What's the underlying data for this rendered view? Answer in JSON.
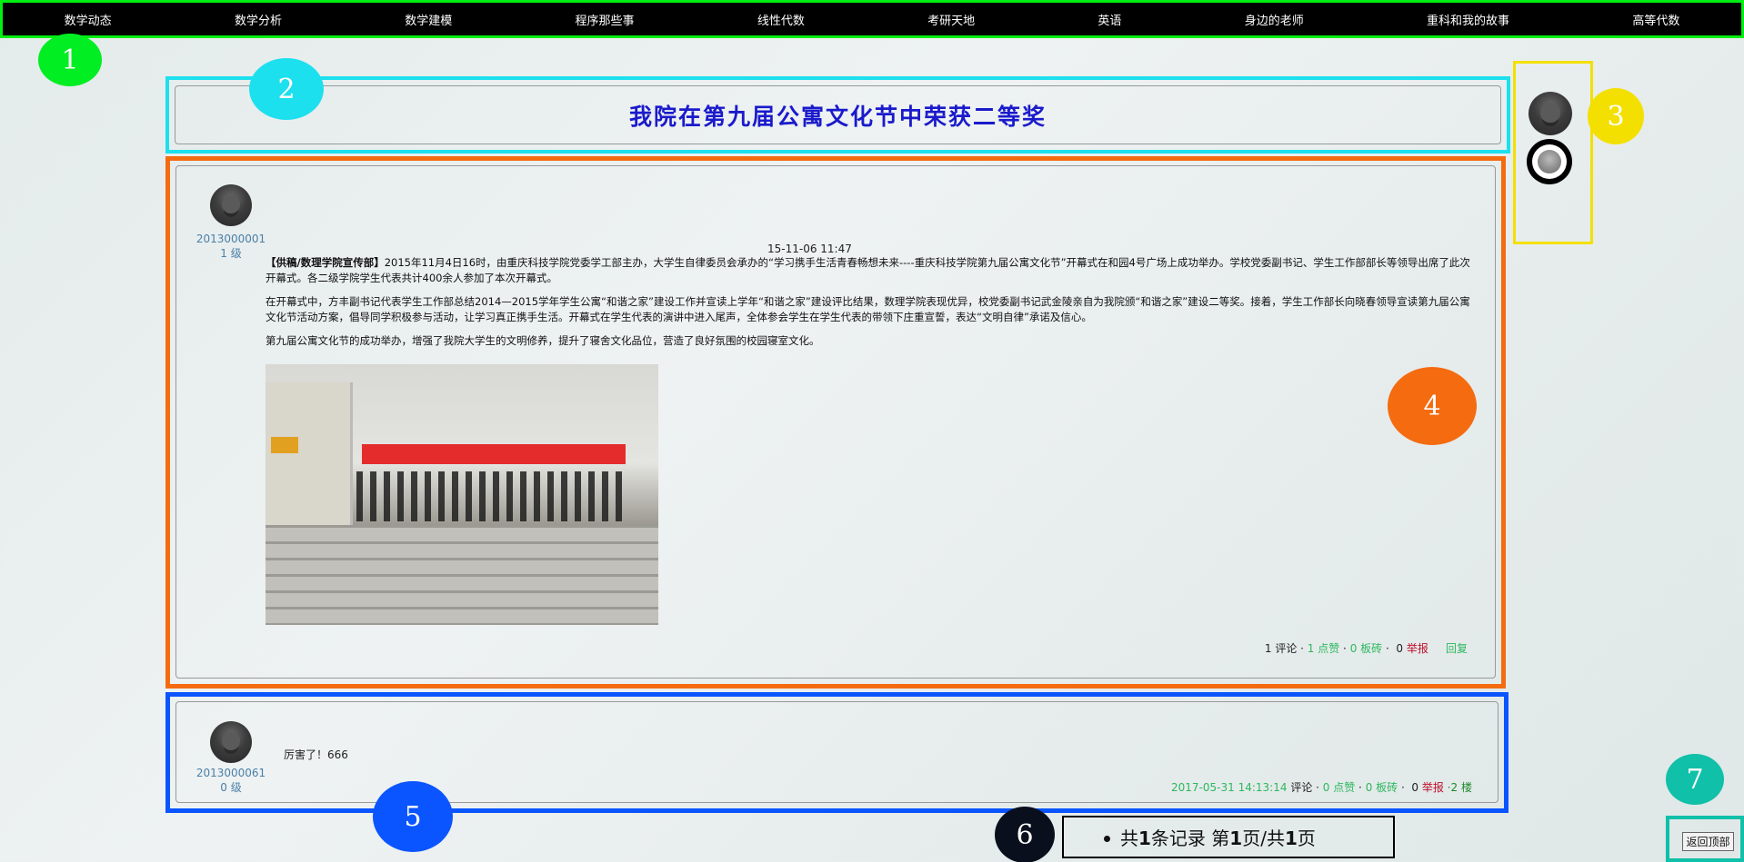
{
  "nav": {
    "items": [
      "数学动态",
      "数学分析",
      "数学建模",
      "程序那些事",
      "线性代数",
      "考研天地",
      "英语",
      "身边的老师",
      "重科和我的故事",
      "高等代数"
    ]
  },
  "markers": [
    "1",
    "2",
    "3",
    "4",
    "5",
    "6",
    "7"
  ],
  "title": "我院在第九届公寓文化节中荣获二等奖",
  "post": {
    "user_id": "2013000001",
    "level": "1 级",
    "time": "15-11-06 11:47",
    "source": "【供稿/数理学院宣传部】",
    "para1": "2015年11月4日16时，由重庆科技学院党委学工部主办，大学生自律委员会承办的“学习携手生活青春畅想未来----重庆科技学院第九届公寓文化节”开幕式在和园4号广场上成功举办。学校党委副书记、学生工作部部长等领导出席了此次开幕式。各二级学院学生代表共计400余人参加了本次开幕式。",
    "para2": "在开幕式中，方丰副书记代表学生工作部总结2014—2015学年学生公寓“和谐之家”建设工作并宣读上学年“和谐之家”建设评比结果，数理学院表现优异，校党委副书记武金陵亲自为我院颁“和谐之家”建设二等奖。接着，学生工作部长向晓春领导宣读第九届公寓文化节活动方案，倡导同学积极参与活动，让学习真正携手生活。开幕式在学生代表的演讲中进入尾声，全体参会学生在学生代表的带领下庄重宣誓，表达“文明自律”承诺及信心。",
    "para3": "第九届公寓文化节的成功举办，增强了我院大学生的文明修养，提升了寝舍文化品位，营造了良好氛围的校园寝室文化。",
    "stats": {
      "comments": "1 评论",
      "sep1": " · ",
      "likes": "1 点赞",
      "sep2": " · ",
      "bricks": "0 板砖",
      "sep3": " · ",
      "report_count": "0",
      "report": "举报",
      "reply": "回复"
    }
  },
  "reply": {
    "user_id": "2013000061",
    "level": "0 级",
    "text": "厉害了！666",
    "time": "2017-05-31 14:13:14",
    "comments": "评论",
    "sep": " · ",
    "likes": "0 点赞",
    "bricks": "0 板砖",
    "report_count": "0",
    "report": "举报",
    "floor_sep": " ·2 ",
    "floor": "楼"
  },
  "pager": {
    "prefix": "共",
    "total": "1",
    "mid1": "条记录 第",
    "page": "1",
    "mid2": "页/共",
    "pages": "1",
    "suffix": "页"
  },
  "back_top": "返回顶部"
}
